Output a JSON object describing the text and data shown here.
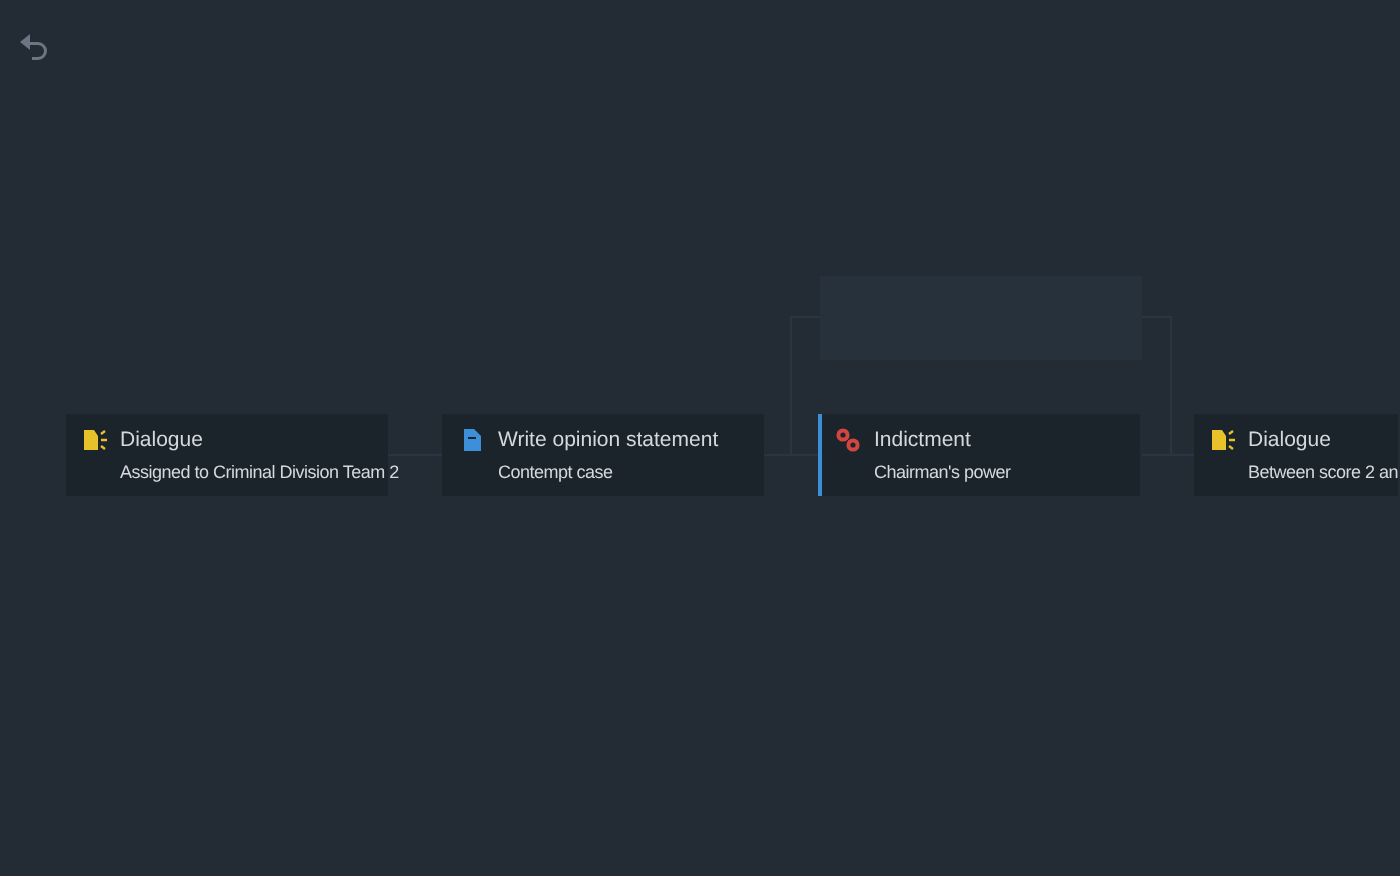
{
  "cards": [
    {
      "kind": "dialogue",
      "title": "Dialogue",
      "subtitle": "Assigned to Criminal Division Team 2",
      "selected": false
    },
    {
      "kind": "document",
      "title": "Write opinion statement",
      "subtitle": "Contempt case",
      "selected": false
    },
    {
      "kind": "indictment",
      "title": "Indictment",
      "subtitle": "Chairman's power",
      "selected": true
    },
    {
      "kind": "dialogue",
      "title": "Dialogue",
      "subtitle": "Between score 2 an",
      "selected": false
    }
  ]
}
